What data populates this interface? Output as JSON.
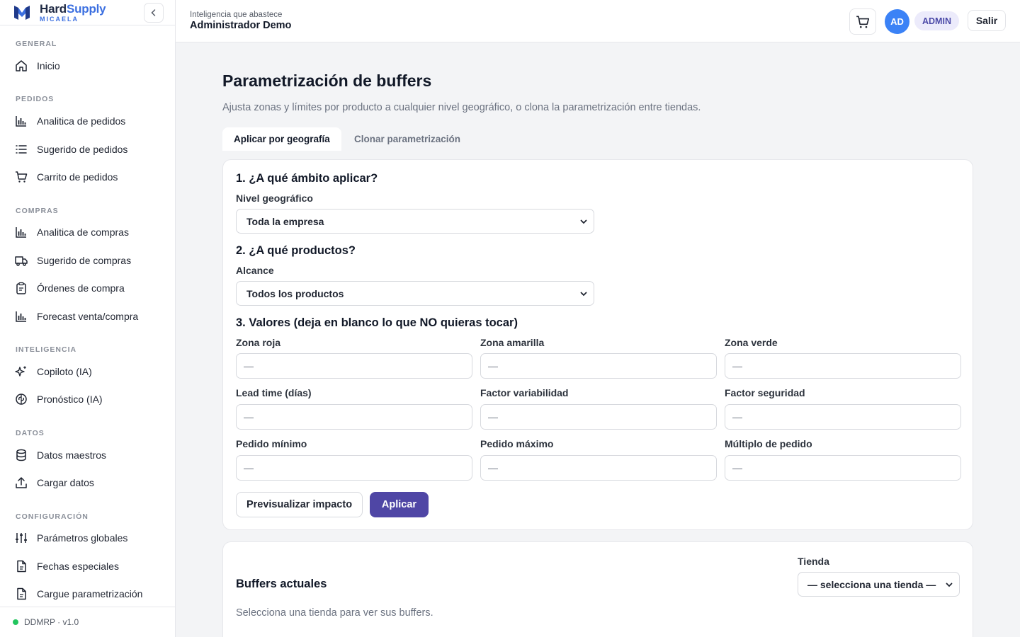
{
  "brand": {
    "name_part1": "Hard",
    "name_part2": "Supply",
    "subtitle": "MICAELA"
  },
  "sidebar": {
    "sections": [
      {
        "label": "GENERAL",
        "items": [
          {
            "label": "Inicio",
            "icon": "home-icon"
          }
        ]
      },
      {
        "label": "PEDIDOS",
        "items": [
          {
            "label": "Analitica de pedidos",
            "icon": "bar-chart-icon"
          },
          {
            "label": "Sugerido de pedidos",
            "icon": "list-icon"
          },
          {
            "label": "Carrito de pedidos",
            "icon": "cart-icon"
          }
        ]
      },
      {
        "label": "COMPRAS",
        "items": [
          {
            "label": "Analitica de compras",
            "icon": "bar-chart-icon"
          },
          {
            "label": "Sugerido de compras",
            "icon": "truck-icon"
          },
          {
            "label": "Órdenes de compra",
            "icon": "clipboard-icon"
          },
          {
            "label": "Forecast venta/compra",
            "icon": "bar-chart-icon"
          }
        ]
      },
      {
        "label": "INTELIGENCIA",
        "items": [
          {
            "label": "Copiloto (IA)",
            "icon": "sparkles-icon"
          },
          {
            "label": "Pronóstico (IA)",
            "icon": "brain-icon"
          }
        ]
      },
      {
        "label": "DATOS",
        "items": [
          {
            "label": "Datos maestros",
            "icon": "database-icon"
          },
          {
            "label": "Cargar datos",
            "icon": "upload-icon"
          }
        ]
      },
      {
        "label": "CONFIGURACIÓN",
        "items": [
          {
            "label": "Parámetros globales",
            "icon": "sliders-icon"
          },
          {
            "label": "Fechas especiales",
            "icon": "file-icon"
          },
          {
            "label": "Cargue parametrización",
            "icon": "file-icon"
          }
        ]
      }
    ],
    "footer": "DDMRP · v1.0"
  },
  "header": {
    "subtitle": "Inteligencia que abastece",
    "title": "Administrador Demo",
    "avatar_initials": "AD",
    "role": "ADMIN",
    "logout_label": "Salir"
  },
  "main": {
    "title": "Parametrización de buffers",
    "description": "Ajusta zonas y límites por producto a cualquier nivel geográfico, o clona la parametrización entre tiendas.",
    "tabs": [
      {
        "label": "Aplicar por geografía",
        "active": true
      },
      {
        "label": "Clonar parametrización",
        "active": false
      }
    ],
    "step1": {
      "heading": "1. ¿A qué ámbito aplicar?",
      "label": "Nivel geográfico",
      "value": "Toda la empresa"
    },
    "step2": {
      "heading": "2. ¿A qué productos?",
      "label": "Alcance",
      "value": "Todos los productos"
    },
    "step3": {
      "heading": "3. Valores (deja en blanco lo que NO quieras tocar)",
      "fields": [
        {
          "label": "Zona roja",
          "placeholder": "—"
        },
        {
          "label": "Zona amarilla",
          "placeholder": "—"
        },
        {
          "label": "Zona verde",
          "placeholder": "—"
        },
        {
          "label": "Lead time (días)",
          "placeholder": "—"
        },
        {
          "label": "Factor variabilidad",
          "placeholder": "—"
        },
        {
          "label": "Factor seguridad",
          "placeholder": "—"
        },
        {
          "label": "Pedido mínimo",
          "placeholder": "—"
        },
        {
          "label": "Pedido máximo",
          "placeholder": "—"
        },
        {
          "label": "Múltiplo de pedido",
          "placeholder": "—"
        }
      ]
    },
    "buttons": {
      "preview": "Previsualizar impacto",
      "apply": "Aplicar"
    },
    "buffers": {
      "title": "Buffers actuales",
      "store_label": "Tienda",
      "store_value": "— selecciona una tienda —",
      "empty_text": "Selecciona una tienda para ver sus buffers."
    }
  },
  "colors": {
    "accent": "#4f46a5",
    "brand_blue": "#3b6fe0",
    "avatar": "#3b82f6",
    "status_ok": "#22c55e"
  }
}
